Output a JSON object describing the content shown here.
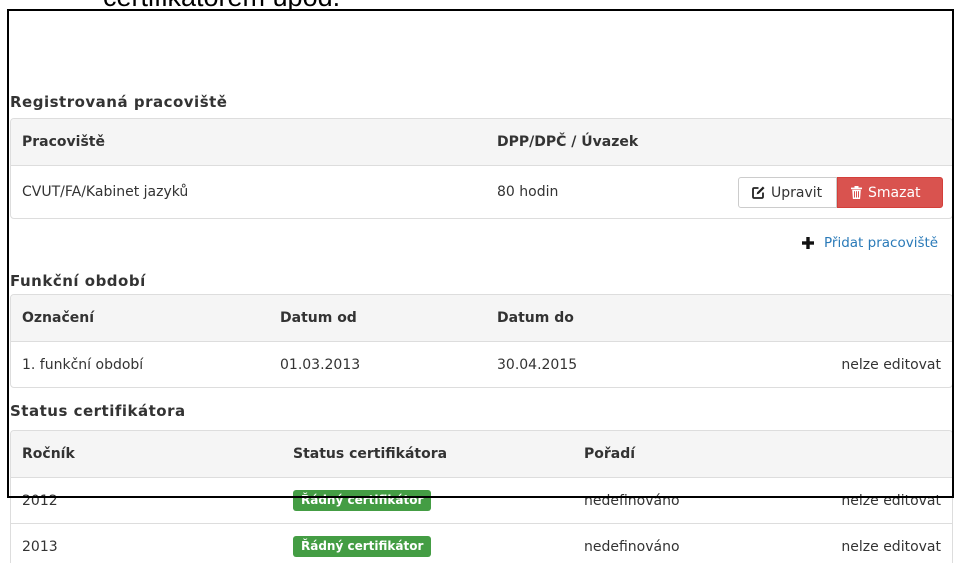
{
  "top_note": "certifikátorem úpod.",
  "colors": {
    "text": "#333333",
    "header_bg": "#f5f5f5",
    "border": "#dddddd",
    "danger": "#d9534f",
    "success": "#449d44",
    "link": "#2a7ab8"
  },
  "icons": {
    "edit": "edit-icon",
    "delete": "trash-icon",
    "add": "plus-icon"
  },
  "workplaces": {
    "heading": "Registrovaná pracoviště",
    "columns": [
      "Pracoviště",
      "DPP/DPČ / Úvazek"
    ],
    "rows": [
      {
        "workplace": "CVUT/FA/Kabinet jazyků",
        "scope": "80 hodin",
        "edit_label": "Upravit",
        "delete_label": "Smazat"
      }
    ],
    "add_label": "Přidat pracoviště"
  },
  "terms": {
    "heading": "Funkční období",
    "columns": [
      "Označení",
      "Datum od",
      "Datum do"
    ],
    "rows": [
      {
        "label": "1. funkční období",
        "date_from": "01.03.2013",
        "date_to": "30.04.2015",
        "note": "nelze editovat"
      }
    ]
  },
  "certifier_status": {
    "heading": "Status certifikátora",
    "columns": [
      "Ročník",
      "Status certifikátora",
      "Pořadí"
    ],
    "rows": [
      {
        "year": "2012",
        "status": "Řádný certifikátor",
        "order": "nedefinováno",
        "note": "nelze editovat"
      },
      {
        "year": "2013",
        "status": "Řádný certifikátor",
        "order": "nedefinováno",
        "note": "nelze editovat"
      }
    ]
  }
}
